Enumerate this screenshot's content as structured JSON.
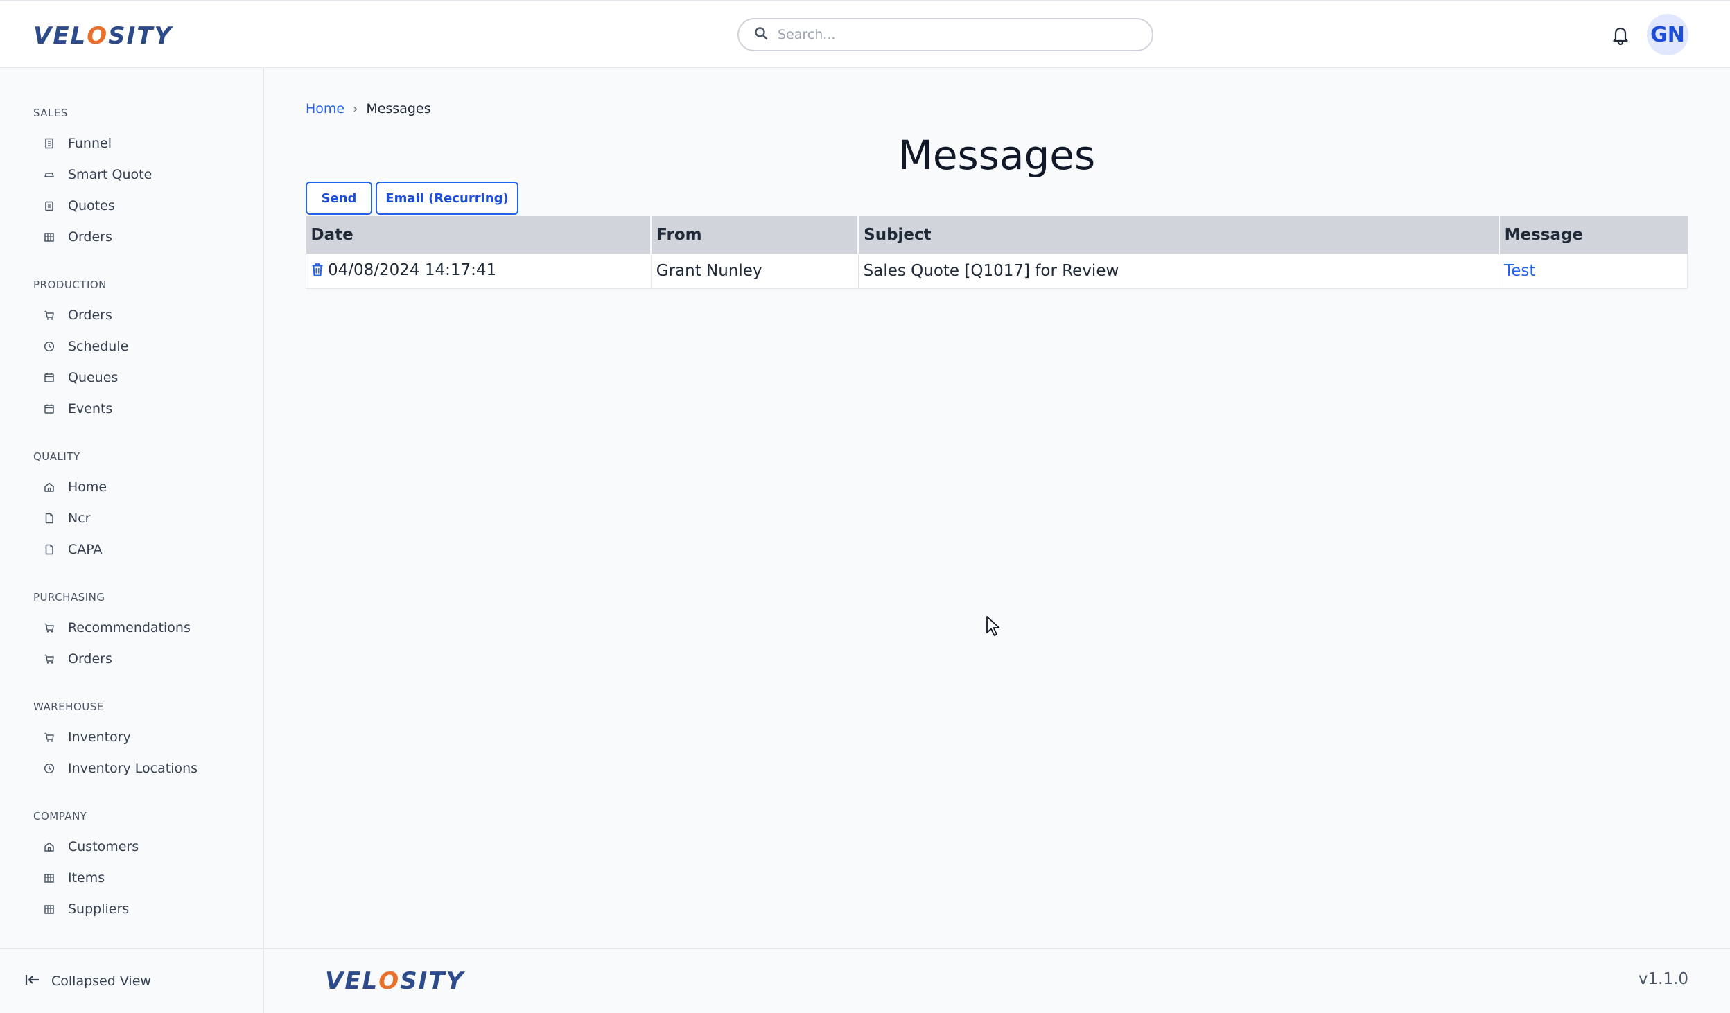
{
  "header": {
    "logo_prefix": "VEL",
    "logo_o": "O",
    "logo_suffix": "SITY",
    "search_placeholder": "Search...",
    "avatar_initials": "GN"
  },
  "sidebar": {
    "sections": [
      {
        "title": "SALES",
        "items": [
          {
            "label": "Funnel",
            "icon": "building-icon"
          },
          {
            "label": "Smart Quote",
            "icon": "car-icon"
          },
          {
            "label": "Quotes",
            "icon": "clipboard-icon"
          },
          {
            "label": "Orders",
            "icon": "store-icon"
          }
        ]
      },
      {
        "title": "PRODUCTION",
        "items": [
          {
            "label": "Orders",
            "icon": "cart-icon"
          },
          {
            "label": "Schedule",
            "icon": "clock-icon"
          },
          {
            "label": "Queues",
            "icon": "calendar-icon"
          },
          {
            "label": "Events",
            "icon": "calendar-icon"
          }
        ]
      },
      {
        "title": "QUALITY",
        "items": [
          {
            "label": "Home",
            "icon": "home-icon"
          },
          {
            "label": "Ncr",
            "icon": "document-icon"
          },
          {
            "label": "CAPA",
            "icon": "document-icon"
          }
        ]
      },
      {
        "title": "PURCHASING",
        "items": [
          {
            "label": "Recommendations",
            "icon": "cart-icon"
          },
          {
            "label": "Orders",
            "icon": "cart-icon"
          }
        ]
      },
      {
        "title": "WAREHOUSE",
        "items": [
          {
            "label": "Inventory",
            "icon": "cart-icon"
          },
          {
            "label": "Inventory Locations",
            "icon": "clock-icon"
          }
        ]
      },
      {
        "title": "COMPANY",
        "items": [
          {
            "label": "Customers",
            "icon": "home-icon"
          },
          {
            "label": "Items",
            "icon": "store-icon"
          },
          {
            "label": "Suppliers",
            "icon": "store-icon"
          }
        ]
      }
    ],
    "collapse_label": "Collapsed View"
  },
  "breadcrumb": {
    "home": "Home",
    "current": "Messages"
  },
  "page": {
    "title": "Messages",
    "send_label": "Send",
    "email_recurring_label": "Email (Recurring)"
  },
  "table": {
    "columns": [
      "Date",
      "From",
      "Subject",
      "Message"
    ],
    "rows": [
      {
        "date": "04/08/2024 14:17:41",
        "from": "Grant Nunley",
        "subject": "Sales Quote [Q1017] for Review",
        "message": "Test"
      }
    ]
  },
  "footer": {
    "version": "v1.1.0"
  },
  "colors": {
    "accent": "#2563eb",
    "logo_blue": "#2d4a8a",
    "logo_orange": "#e8702a",
    "header_row": "#d1d5db"
  }
}
